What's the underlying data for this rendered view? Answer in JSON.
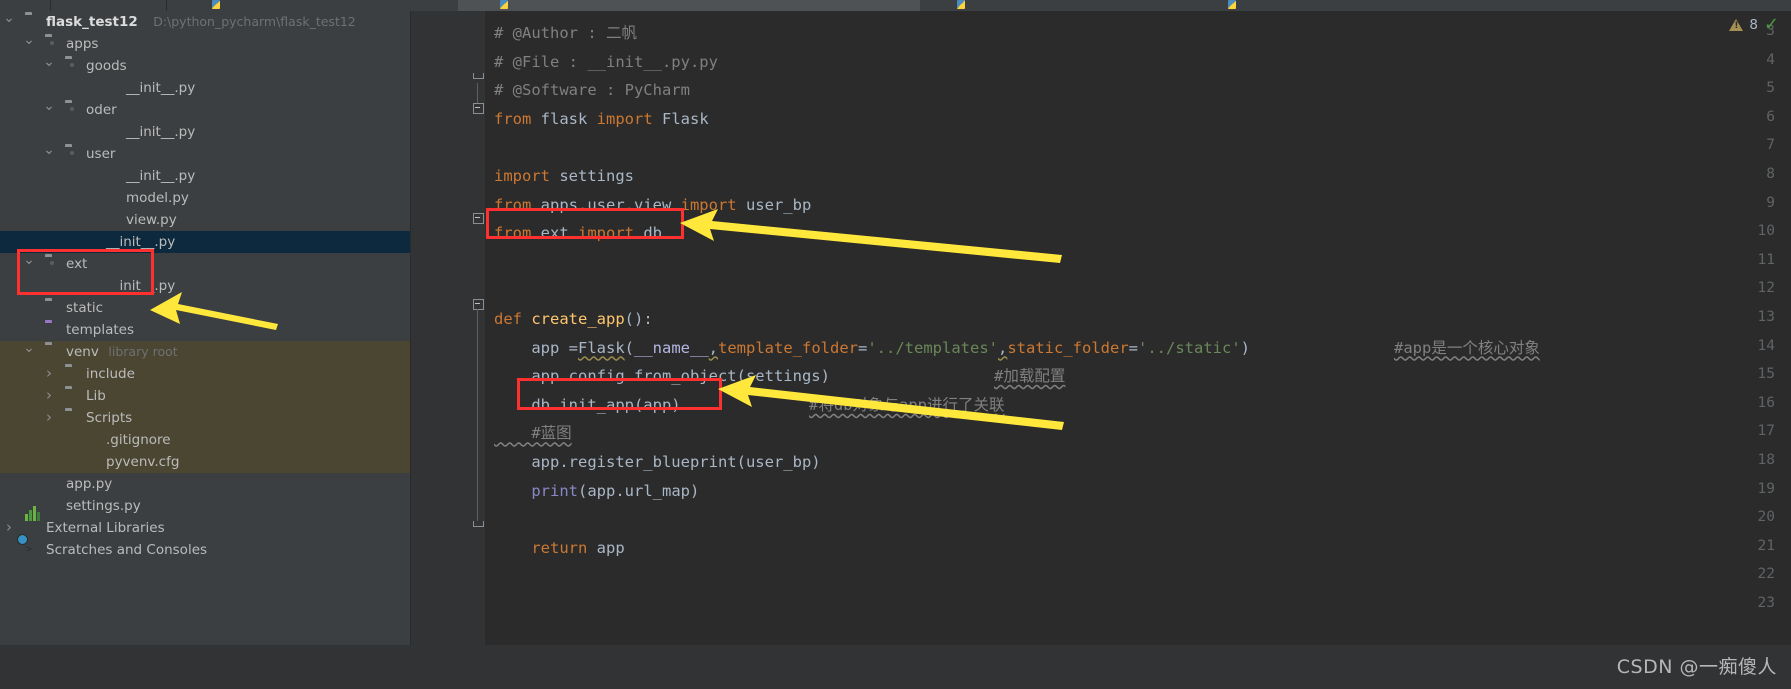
{
  "app": {
    "name": "PyCharm",
    "theme_bg": "#2b2b2b",
    "panel_bg": "#3c3f41",
    "selection_bg": "#0d293e",
    "venv_bg": "#4b4632",
    "annotation_red": "#ff3030",
    "annotation_yellow": "#ffeb3b"
  },
  "project_panel": {
    "root": {
      "label": "flask_test12",
      "path": "D:\\python_pycharm\\flask_test12"
    },
    "tree": [
      {
        "label": "flask_test12",
        "sublabel": "D:\\python_pycharm\\flask_test12",
        "icon": "folder-icon",
        "depth": 0,
        "arrow": "expanded",
        "bold": true,
        "state": "normal"
      },
      {
        "label": "apps",
        "sublabel": "",
        "icon": "module-folder-icon",
        "depth": 1,
        "arrow": "expanded",
        "bold": false,
        "state": "normal"
      },
      {
        "label": "goods",
        "sublabel": "",
        "icon": "module-folder-icon",
        "depth": 2,
        "arrow": "expanded",
        "bold": false,
        "state": "normal"
      },
      {
        "label": "__init__.py",
        "sublabel": "",
        "icon": "python-file-icon",
        "depth": 4,
        "arrow": "",
        "bold": false,
        "state": "normal"
      },
      {
        "label": "oder",
        "sublabel": "",
        "icon": "module-folder-icon",
        "depth": 2,
        "arrow": "expanded",
        "bold": false,
        "state": "normal"
      },
      {
        "label": "__init__.py",
        "sublabel": "",
        "icon": "python-file-icon",
        "depth": 4,
        "arrow": "",
        "bold": false,
        "state": "normal"
      },
      {
        "label": "user",
        "sublabel": "",
        "icon": "module-folder-icon",
        "depth": 2,
        "arrow": "expanded",
        "bold": false,
        "state": "normal"
      },
      {
        "label": "__init__.py",
        "sublabel": "",
        "icon": "python-file-icon",
        "depth": 4,
        "arrow": "",
        "bold": false,
        "state": "normal"
      },
      {
        "label": "model.py",
        "sublabel": "",
        "icon": "python-file-icon",
        "depth": 4,
        "arrow": "",
        "bold": false,
        "state": "normal"
      },
      {
        "label": "view.py",
        "sublabel": "",
        "icon": "python-file-icon",
        "depth": 4,
        "arrow": "",
        "bold": false,
        "state": "normal"
      },
      {
        "label": "__init__.py",
        "sublabel": "",
        "icon": "python-file-icon",
        "depth": 3,
        "arrow": "",
        "bold": false,
        "state": "selected"
      },
      {
        "label": "ext",
        "sublabel": "",
        "icon": "module-folder-icon",
        "depth": 1,
        "arrow": "expanded",
        "bold": false,
        "state": "normal"
      },
      {
        "label": "__init__.py",
        "sublabel": "",
        "icon": "python-file-icon",
        "depth": 3,
        "arrow": "",
        "bold": false,
        "state": "normal"
      },
      {
        "label": "static",
        "sublabel": "",
        "icon": "folder-icon",
        "depth": 1,
        "arrow": "",
        "bold": false,
        "state": "normal"
      },
      {
        "label": "templates",
        "sublabel": "",
        "icon": "templates-folder-icon",
        "depth": 1,
        "arrow": "",
        "bold": false,
        "state": "normal"
      },
      {
        "label": "venv",
        "sublabel": "library root",
        "icon": "folder-icon",
        "depth": 1,
        "arrow": "expanded",
        "bold": false,
        "state": "venv"
      },
      {
        "label": "include",
        "sublabel": "",
        "icon": "folder-icon",
        "depth": 2,
        "arrow": "collapsed",
        "bold": false,
        "state": "venv"
      },
      {
        "label": "Lib",
        "sublabel": "",
        "icon": "folder-icon",
        "depth": 2,
        "arrow": "collapsed",
        "bold": false,
        "state": "venv"
      },
      {
        "label": "Scripts",
        "sublabel": "",
        "icon": "folder-icon",
        "depth": 2,
        "arrow": "collapsed",
        "bold": false,
        "state": "venv"
      },
      {
        "label": ".gitignore",
        "sublabel": "",
        "icon": "gitignore-file-icon",
        "depth": 3,
        "arrow": "",
        "bold": false,
        "state": "venv"
      },
      {
        "label": "pyvenv.cfg",
        "sublabel": "",
        "icon": "config-file-icon",
        "depth": 3,
        "arrow": "",
        "bold": false,
        "state": "venv"
      },
      {
        "label": "app.py",
        "sublabel": "",
        "icon": "python-file-icon",
        "depth": 1,
        "arrow": "",
        "bold": false,
        "state": "normal"
      },
      {
        "label": "settings.py",
        "sublabel": "",
        "icon": "python-file-icon",
        "depth": 1,
        "arrow": "",
        "bold": false,
        "state": "normal"
      },
      {
        "label": "External Libraries",
        "sublabel": "",
        "icon": "external-libraries-icon",
        "depth": 0,
        "arrow": "collapsed",
        "bold": false,
        "state": "normal"
      },
      {
        "label": "Scratches and Consoles",
        "sublabel": "",
        "icon": "scratches-icon",
        "depth": 0,
        "arrow": "",
        "bold": false,
        "state": "normal"
      }
    ]
  },
  "editor": {
    "inspection": {
      "warning_count": "8",
      "warning_icon": "warning-triangle-icon",
      "ok_icon": "checkmark-icon"
    },
    "lines": [
      {
        "num": "3",
        "tokens": [
          {
            "t": "# @Author : 二帆",
            "c": "tok-cmt"
          }
        ]
      },
      {
        "num": "4",
        "tokens": [
          {
            "t": "# @File : __init__.py.py",
            "c": "tok-cmt"
          }
        ]
      },
      {
        "num": "5",
        "tokens": [
          {
            "t": "# @Software : PyCharm",
            "c": "tok-cmt"
          }
        ]
      },
      {
        "num": "6",
        "tokens": [
          {
            "t": "from",
            "c": "tok-kw"
          },
          {
            "t": " flask ",
            "c": "tok-plain"
          },
          {
            "t": "import",
            "c": "tok-kw"
          },
          {
            "t": " Flask",
            "c": "tok-plain"
          }
        ]
      },
      {
        "num": "7",
        "tokens": []
      },
      {
        "num": "8",
        "tokens": [
          {
            "t": "import",
            "c": "tok-kw"
          },
          {
            "t": " settings",
            "c": "tok-plain"
          }
        ]
      },
      {
        "num": "9",
        "tokens": [
          {
            "t": "from",
            "c": "tok-kw"
          },
          {
            "t": " apps.user.view ",
            "c": "tok-plain"
          },
          {
            "t": "import",
            "c": "tok-kw"
          },
          {
            "t": " user_bp",
            "c": "tok-plain"
          }
        ]
      },
      {
        "num": "10",
        "tokens": [
          {
            "t": "from",
            "c": "tok-kw"
          },
          {
            "t": " ext ",
            "c": "tok-plain"
          },
          {
            "t": "import",
            "c": "tok-kw"
          },
          {
            "t": " db",
            "c": "tok-plain"
          }
        ]
      },
      {
        "num": "11",
        "tokens": []
      },
      {
        "num": "12",
        "tokens": []
      },
      {
        "num": "13",
        "tokens": [
          {
            "t": "def",
            "c": "tok-kw"
          },
          {
            "t": " ",
            "c": "tok-plain"
          },
          {
            "t": "create_app",
            "c": "tok-fn"
          },
          {
            "t": "():",
            "c": "tok-plain"
          }
        ]
      },
      {
        "num": "14",
        "tokens": [
          {
            "t": "    app =",
            "c": "tok-plain"
          },
          {
            "t": "Flask",
            "c": "tok-plain squiggle-warn"
          },
          {
            "t": "(",
            "c": "tok-plain"
          },
          {
            "t": "__name__",
            "c": "tok-dunder"
          },
          {
            "t": ",",
            "c": "tok-plain squiggle-warn"
          },
          {
            "t": "template_folder",
            "c": "tok-param"
          },
          {
            "t": "=",
            "c": "tok-plain"
          },
          {
            "t": "'../templates'",
            "c": "tok-str"
          },
          {
            "t": ",",
            "c": "tok-plain squiggle-warn"
          },
          {
            "t": "static_folder",
            "c": "tok-param"
          },
          {
            "t": "=",
            "c": "tok-plain"
          },
          {
            "t": "'../static'",
            "c": "tok-str"
          },
          {
            "t": ")",
            "c": "tok-plain"
          }
        ]
      },
      {
        "num": "15",
        "tokens": [
          {
            "t": "    app.config.from_object(settings)",
            "c": "tok-plain"
          }
        ]
      },
      {
        "num": "16",
        "tokens": [
          {
            "t": "    db.init_app(app)",
            "c": "tok-plain"
          }
        ]
      },
      {
        "num": "17",
        "tokens": [
          {
            "t": "    #蓝图",
            "c": "tok-cmt squiggle"
          }
        ]
      },
      {
        "num": "18",
        "tokens": [
          {
            "t": "    app.register_blueprint(user_bp)",
            "c": "tok-plain"
          }
        ]
      },
      {
        "num": "19",
        "tokens": [
          {
            "t": "    ",
            "c": "tok-plain"
          },
          {
            "t": "print",
            "c": "tok-builtin"
          },
          {
            "t": "(app.url_map)",
            "c": "tok-plain"
          }
        ]
      },
      {
        "num": "20",
        "tokens": []
      },
      {
        "num": "21",
        "tokens": [
          {
            "t": "    ",
            "c": "tok-plain"
          },
          {
            "t": "return",
            "c": "tok-kw"
          },
          {
            "t": " app",
            "c": "tok-plain"
          }
        ]
      },
      {
        "num": "22",
        "tokens": []
      },
      {
        "num": "23",
        "tokens": []
      }
    ],
    "trailing_comments": [
      {
        "line": "14",
        "text": "#app是一个核心对象"
      },
      {
        "line": "15",
        "text": "#加载配置"
      },
      {
        "line": "16",
        "text": "#将db对象与app进行了关联"
      }
    ]
  },
  "annotations": {
    "red_boxes": [
      {
        "name": "ext-folder-highlight"
      },
      {
        "name": "import-db-highlight"
      },
      {
        "name": "db-init-app-highlight"
      }
    ],
    "arrows": [
      {
        "name": "arrow-to-ext-folder"
      },
      {
        "name": "arrow-to-import-db"
      },
      {
        "name": "arrow-to-db-init-app"
      }
    ]
  },
  "watermark": {
    "text": "CSDN @一痴傻人"
  }
}
